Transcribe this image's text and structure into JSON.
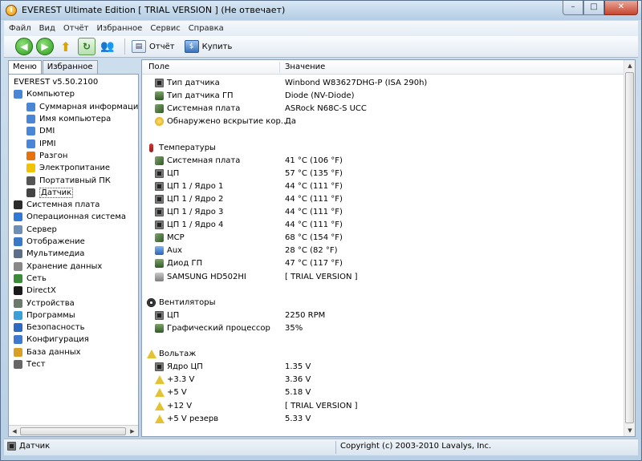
{
  "window": {
    "title": "EVEREST Ultimate Edition  [ TRIAL VERSION ] (Не отвечает)",
    "buttons": {
      "minimize": "–",
      "maximize": "□",
      "close": "✕"
    }
  },
  "menu": [
    "Файл",
    "Вид",
    "Отчёт",
    "Избранное",
    "Сервис",
    "Справка"
  ],
  "toolbar": {
    "report_label": "Отчёт",
    "buy_label": "Купить"
  },
  "left": {
    "tabs": [
      "Меню",
      "Избранное"
    ],
    "tree": [
      {
        "label": "EVEREST v5.50.2100",
        "level": 0,
        "icon": "none"
      },
      {
        "label": "Компьютер",
        "level": 0,
        "icon": "computer-icon"
      },
      {
        "label": "Суммарная информация",
        "level": 1,
        "icon": "computer-icon"
      },
      {
        "label": "Имя компьютера",
        "level": 1,
        "icon": "computer-icon"
      },
      {
        "label": "DMI",
        "level": 1,
        "icon": "computer-icon"
      },
      {
        "label": "IPMI",
        "level": 1,
        "icon": "computer-icon"
      },
      {
        "label": "Разгон",
        "level": 1,
        "icon": "flame-icon"
      },
      {
        "label": "Электропитание",
        "level": 1,
        "icon": "power-icon"
      },
      {
        "label": "Портативный ПК",
        "level": 1,
        "icon": "laptop-icon"
      },
      {
        "label": "Датчик",
        "level": 1,
        "icon": "sensor-icon"
      },
      {
        "label": "Системная плата",
        "level": 0,
        "icon": "chip-icon"
      },
      {
        "label": "Операционная система",
        "level": 0,
        "icon": "windows-icon"
      },
      {
        "label": "Сервер",
        "level": 0,
        "icon": "server-icon"
      },
      {
        "label": "Отображение",
        "level": 0,
        "icon": "monitor-icon"
      },
      {
        "label": "Мультимедиа",
        "level": 0,
        "icon": "multimedia-icon"
      },
      {
        "label": "Хранение данных",
        "level": 0,
        "icon": "storage-icon"
      },
      {
        "label": "Сеть",
        "level": 0,
        "icon": "network-icon"
      },
      {
        "label": "DirectX",
        "level": 0,
        "icon": "directx-icon"
      },
      {
        "label": "Устройства",
        "level": 0,
        "icon": "devices-icon"
      },
      {
        "label": "Программы",
        "level": 0,
        "icon": "programs-icon"
      },
      {
        "label": "Безопасность",
        "level": 0,
        "icon": "security-icon"
      },
      {
        "label": "Конфигурация",
        "level": 0,
        "icon": "config-icon"
      },
      {
        "label": "База данных",
        "level": 0,
        "icon": "database-icon"
      },
      {
        "label": "Тест",
        "level": 0,
        "icon": "test-icon"
      }
    ],
    "selected": "Датчик"
  },
  "table": {
    "headers": {
      "field": "Поле",
      "value": "Значение"
    },
    "rows": [
      {
        "type": "item",
        "field": "Тип датчика",
        "value": "Winbond W83627DHG-P  (ISA 290h)",
        "icon": "chip"
      },
      {
        "type": "item",
        "field": "Тип датчика ГП",
        "value": "Diode  (NV-Diode)",
        "icon": "gpu"
      },
      {
        "type": "item",
        "field": "Системная плата",
        "value": "ASRock N68C-S UCC",
        "icon": "mb"
      },
      {
        "type": "item",
        "field": "Обнаружено вскрытие кор...",
        "value": "Да",
        "icon": "lock"
      },
      {
        "type": "blank"
      },
      {
        "type": "group",
        "field": "Температуры",
        "icon": "therm"
      },
      {
        "type": "item",
        "field": "Системная плата",
        "value": "41 °C  (106 °F)",
        "icon": "mb"
      },
      {
        "type": "item",
        "field": "ЦП",
        "value": "57 °C  (135 °F)",
        "icon": "chip"
      },
      {
        "type": "item",
        "field": "ЦП 1 / Ядро 1",
        "value": "44 °C  (111 °F)",
        "icon": "chip"
      },
      {
        "type": "item",
        "field": "ЦП 1 / Ядро 2",
        "value": "44 °C  (111 °F)",
        "icon": "chip"
      },
      {
        "type": "item",
        "field": "ЦП 1 / Ядро 3",
        "value": "44 °C  (111 °F)",
        "icon": "chip"
      },
      {
        "type": "item",
        "field": "ЦП 1 / Ядро 4",
        "value": "44 °C  (111 °F)",
        "icon": "chip"
      },
      {
        "type": "item",
        "field": "MCP",
        "value": "68 °C  (154 °F)",
        "icon": "mb"
      },
      {
        "type": "item",
        "field": "Aux",
        "value": "28 °C  (82 °F)",
        "icon": "aux"
      },
      {
        "type": "item",
        "field": "Диод ГП",
        "value": "47 °C  (117 °F)",
        "icon": "gpu"
      },
      {
        "type": "item",
        "field": "SAMSUNG HD502HI",
        "value": "[ TRIAL VERSION ]",
        "icon": "hdd"
      },
      {
        "type": "blank"
      },
      {
        "type": "group",
        "field": "Вентиляторы",
        "icon": "fan"
      },
      {
        "type": "item",
        "field": "ЦП",
        "value": "2250 RPM",
        "icon": "chip"
      },
      {
        "type": "item",
        "field": "Графический процессор",
        "value": "35%",
        "icon": "gpu"
      },
      {
        "type": "blank"
      },
      {
        "type": "group",
        "field": "Вольтаж",
        "icon": "warn"
      },
      {
        "type": "item",
        "field": "Ядро ЦП",
        "value": "1.35 V",
        "icon": "chip"
      },
      {
        "type": "item",
        "field": "+3.3 V",
        "value": "3.36 V",
        "icon": "warn"
      },
      {
        "type": "item",
        "field": "+5 V",
        "value": "5.18 V",
        "icon": "warn"
      },
      {
        "type": "item",
        "field": "+12 V",
        "value": "[ TRIAL VERSION ]",
        "icon": "warn"
      },
      {
        "type": "item",
        "field": "+5 V резерв",
        "value": "5.33 V",
        "icon": "warn"
      }
    ]
  },
  "status": {
    "left": "Датчик",
    "right": "Copyright (c) 2003-2010 Lavalys, Inc."
  }
}
